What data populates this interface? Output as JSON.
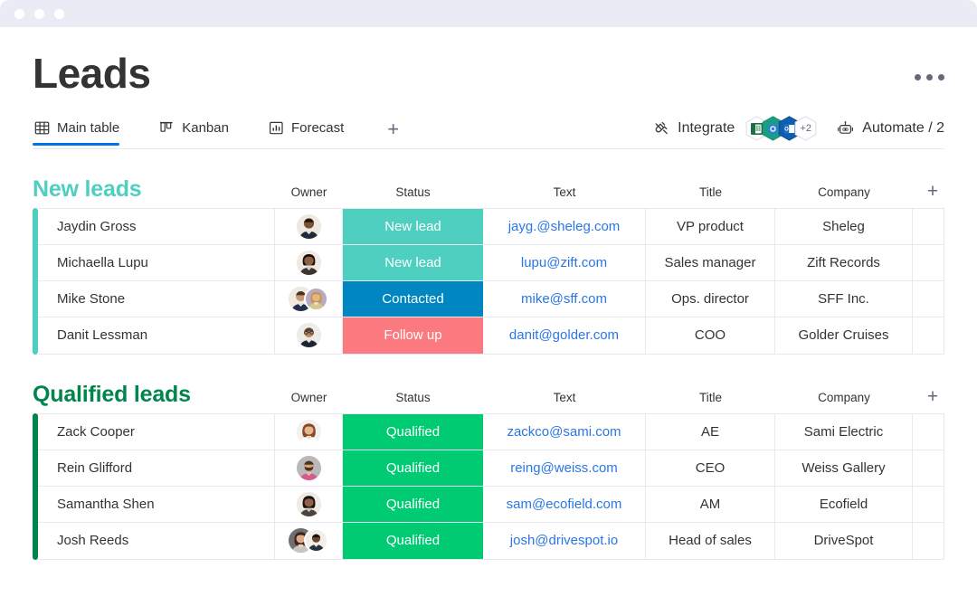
{
  "window": {
    "traffic_dots": 3
  },
  "header": {
    "title": "Leads",
    "overflow_menu": "•••"
  },
  "tabs": [
    {
      "label": "Main table",
      "icon": "table-grid-icon",
      "active": true
    },
    {
      "label": "Kanban",
      "icon": "kanban-board-icon",
      "active": false
    },
    {
      "label": "Forecast",
      "icon": "bar-chart-icon",
      "active": false
    }
  ],
  "add_tab_label": "+",
  "toolbar": {
    "integrate_label": "Integrate",
    "integrate_icon": "plug-icon",
    "integration_badges": [
      {
        "name": "excel-integration",
        "color": "#1d7044",
        "letter": "X"
      },
      {
        "name": "teams-integration",
        "color": "#1b9c85",
        "letter": ""
      },
      {
        "name": "outlook-integration",
        "color": "#0f5eb0",
        "letter": "O"
      }
    ],
    "integration_overflow": "+2",
    "automate_label": "Automate / 2",
    "automate_icon": "robot-icon"
  },
  "columns": {
    "owner": "Owner",
    "status": "Status",
    "text": "Text",
    "title": "Title",
    "company": "Company",
    "add": "+"
  },
  "groups": [
    {
      "name": "new-leads",
      "title": "New leads",
      "color": "#4ecfc0",
      "rows": [
        {
          "name": "Jaydin Gross",
          "owners": [
            "avatar-man-dark-shirt"
          ],
          "status": "New lead",
          "status_color": "#4ecfc0",
          "text": "jayg.@sheleg.com",
          "title": "VP product",
          "company": "Sheleg"
        },
        {
          "name": "Michaella Lupu",
          "owners": [
            "avatar-woman-dark-hair"
          ],
          "status": "New lead",
          "status_color": "#4ecfc0",
          "text": "lupu@zift.com",
          "title": "Sales manager",
          "company": "Zift Records"
        },
        {
          "name": "Mike Stone",
          "owners": [
            "avatar-man-short-hair",
            "avatar-woman-blonde"
          ],
          "status": "Contacted",
          "status_color": "#0086c0",
          "text": "mike@sff.com",
          "title": "Ops. director",
          "company": "SFF Inc."
        },
        {
          "name": "Danit Lessman",
          "owners": [
            "avatar-man-glasses"
          ],
          "status": "Follow up",
          "status_color": "#fb7a7f",
          "text": "danit@golder.com",
          "title": "COO",
          "company": "Golder Cruises"
        }
      ]
    },
    {
      "name": "qualified-leads",
      "title": "Qualified leads",
      "color": "#00854d",
      "rows": [
        {
          "name": "Zack Cooper",
          "owners": [
            "avatar-woman-curly-hair"
          ],
          "status": "Qualified",
          "status_color": "#00ca72",
          "text": "zackco@sami.com",
          "title": "AE",
          "company": "Sami Electric"
        },
        {
          "name": "Rein Glifford",
          "owners": [
            "avatar-man-beard"
          ],
          "status": "Qualified",
          "status_color": "#00ca72",
          "text": "reing@weiss.com",
          "title": "CEO",
          "company": "Weiss Gallery"
        },
        {
          "name": "Samantha Shen",
          "owners": [
            "avatar-woman-smiling"
          ],
          "status": "Qualified",
          "status_color": "#00ca72",
          "text": "sam@ecofield.com",
          "title": "AM",
          "company": "Ecofield"
        },
        {
          "name": "Josh Reeds",
          "owners": [
            "avatar-woman-long-hair",
            "avatar-man-dark-skin"
          ],
          "status": "Qualified",
          "status_color": "#00ca72",
          "text": "josh@drivespot.io",
          "title": "Head of sales",
          "company": "DriveSpot"
        }
      ]
    }
  ],
  "colors": {
    "accent_blue": "#0073ea",
    "link_blue": "#2b76e5",
    "titlebar": "#eaecf5",
    "border": "#e6e9ef",
    "text": "#323338"
  }
}
